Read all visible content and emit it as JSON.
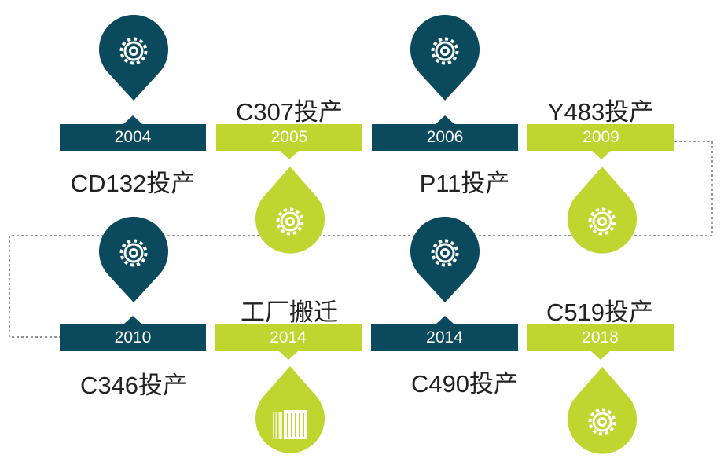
{
  "colors": {
    "dark": "#0b4a5d",
    "light": "#bfd630",
    "connector": "#555555"
  },
  "milestones": [
    {
      "year": "2004",
      "label": "CD132投产",
      "icon": "gear-icon",
      "style": "dark"
    },
    {
      "year": "2005",
      "label": "C307投产",
      "icon": "gear-icon",
      "style": "light"
    },
    {
      "year": "2006",
      "label": "P11投产",
      "icon": "gear-icon",
      "style": "dark"
    },
    {
      "year": "2009",
      "label": "Y483投产",
      "icon": "gear-icon",
      "style": "light"
    },
    {
      "year": "2010",
      "label": "C346投产",
      "icon": "gear-icon",
      "style": "dark"
    },
    {
      "year": "2014",
      "label": "工厂搬迁",
      "icon": "factory-icon",
      "style": "light"
    },
    {
      "year": "2014",
      "label": "C490投产",
      "icon": "gear-icon",
      "style": "dark"
    },
    {
      "year": "2018",
      "label": "C519投产",
      "icon": "gear-icon",
      "style": "light"
    }
  ]
}
